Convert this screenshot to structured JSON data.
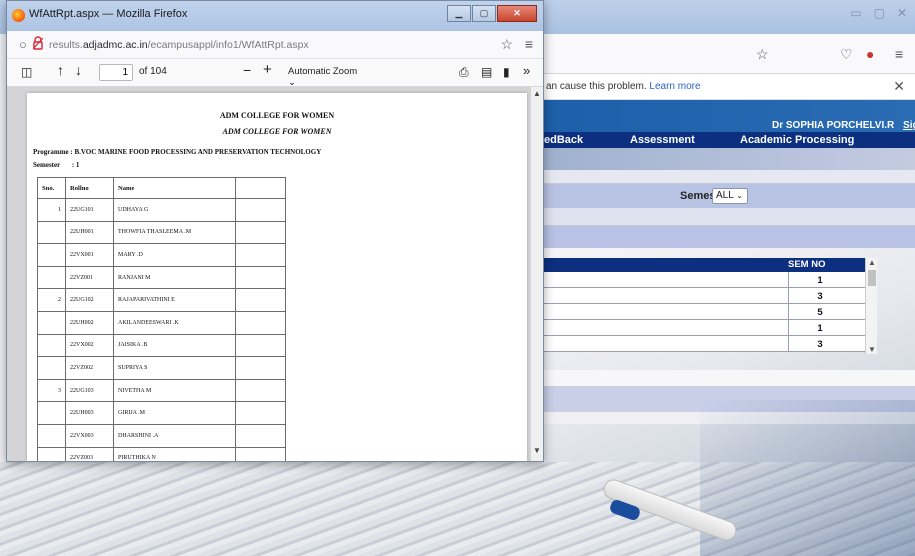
{
  "background_window": {
    "notice_text": "an cause this problem.",
    "notice_link": "Learn more",
    "user_name": "Dr SOPHIA PORCHELVI.R",
    "signout_label": "Sign O",
    "menu": [
      "edBack",
      "Assessment",
      "Academic Processing"
    ],
    "semester_label": "Semester",
    "semester_value": "ALL",
    "table": {
      "header": "SEM NO",
      "rows": [
        "1",
        "3",
        "5",
        "1",
        "3"
      ]
    }
  },
  "popup": {
    "title": "WfAttRpt.aspx — Mozilla Firefox",
    "url_prefix": "results.",
    "url_domain": "adjadmc.ac.in",
    "url_path": "/ecampusappl/info1/WfAttRpt.aspx",
    "pdf_toolbar": {
      "page_value": "1",
      "page_total": "of 104",
      "zoom_label": "Automatic Zoom"
    },
    "pdf": {
      "college_name": "ADM COLLEGE FOR WOMEN",
      "college_name_italic": "ADM COLLEGE FOR WOMEN",
      "programme": "Programme  : B.VOC MARINE FOOD PROCESSING AND PRESERVATION TECHNOLOGY",
      "semester_label": "Semester",
      "semester_value": ":   1",
      "columns": [
        "Sno.",
        "Rollno",
        "Name"
      ],
      "rows": [
        {
          "sno": "1",
          "rollno": "22UG101",
          "name": "UDHAYA G"
        },
        {
          "sno": "",
          "rollno": "22UH001",
          "name": "THOWFIA THASLEEMA .M"
        },
        {
          "sno": "",
          "rollno": "22VX001",
          "name": "MARY .D"
        },
        {
          "sno": "",
          "rollno": "22VZ001",
          "name": "RANJANI M"
        },
        {
          "sno": "2",
          "rollno": "22UG102",
          "name": "RAJAPARIVATHINI E"
        },
        {
          "sno": "",
          "rollno": "22UH002",
          "name": "AKILANDEESWARI .K"
        },
        {
          "sno": "",
          "rollno": "22VX002",
          "name": "JAISIKA .B"
        },
        {
          "sno": "",
          "rollno": "22VZ002",
          "name": "SUPRIYA S"
        },
        {
          "sno": "3",
          "rollno": "22UG103",
          "name": "NIVETHA M"
        },
        {
          "sno": "",
          "rollno": "22UH003",
          "name": "GIRIJA .M"
        },
        {
          "sno": "",
          "rollno": "22VX003",
          "name": "DHARSHINI .A"
        },
        {
          "sno": "",
          "rollno": "22VZ003",
          "name": "PIRUTHIKA N"
        }
      ]
    }
  }
}
